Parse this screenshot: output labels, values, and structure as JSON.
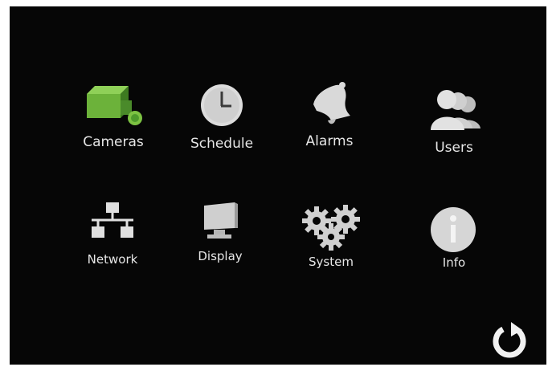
{
  "menu": {
    "items": [
      {
        "id": "cameras",
        "label": "Cameras",
        "icon": "camera-icon"
      },
      {
        "id": "schedule",
        "label": "Schedule",
        "icon": "clock-icon"
      },
      {
        "id": "alarms",
        "label": "Alarms",
        "icon": "bell-icon"
      },
      {
        "id": "users",
        "label": "Users",
        "icon": "users-icon"
      },
      {
        "id": "network",
        "label": "Network",
        "icon": "network-icon"
      },
      {
        "id": "display",
        "label": "Display",
        "icon": "monitor-icon"
      },
      {
        "id": "system",
        "label": "System",
        "icon": "gears-icon"
      },
      {
        "id": "info",
        "label": "Info",
        "icon": "info-icon"
      }
    ]
  },
  "controls": {
    "refresh_icon": "refresh-icon"
  },
  "colors": {
    "background": "#060606",
    "accent": "#7cc242",
    "icon": "#d9d9d9",
    "label": "#e6e6e6"
  }
}
